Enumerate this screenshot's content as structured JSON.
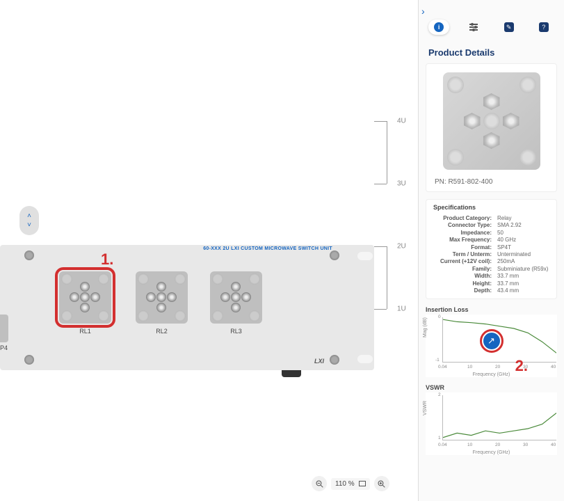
{
  "chassis_header": "60-XXX 2U LXI CUSTOM MICROWAVE SWITCH UNIT",
  "relays": [
    {
      "label": "RL1",
      "selected": true
    },
    {
      "label": "RL2",
      "selected": false
    },
    {
      "label": "RL3",
      "selected": false
    }
  ],
  "partial_label": "P4",
  "lxi_logo": "LXI",
  "rack_units": [
    "4U",
    "3U",
    "2U",
    "1U"
  ],
  "markers": {
    "one": "1.",
    "two": "2."
  },
  "zoom": {
    "out": "−",
    "in": "+",
    "label": "110 %"
  },
  "side_panel": {
    "chevron": "›",
    "section_title": "Product Details",
    "part_number": "PN: R591-802-400",
    "specs_title": "Specifications",
    "specs": [
      {
        "k": "Product Category:",
        "v": "Relay"
      },
      {
        "k": "Connector Type:",
        "v": "SMA 2.92"
      },
      {
        "k": "Impedance:",
        "v": "50"
      },
      {
        "k": "Max Frequency:",
        "v": "40 GHz"
      },
      {
        "k": "Format:",
        "v": "SP4T"
      },
      {
        "k": "Term / Unterm:",
        "v": "Unterminated"
      },
      {
        "k": "Current (+12V coil):",
        "v": "250mA"
      },
      {
        "k": "Family:",
        "v": "Subminiature (R59x)"
      },
      {
        "k": "Width:",
        "v": "33.7 mm"
      },
      {
        "k": "Height:",
        "v": "33.7 mm"
      },
      {
        "k": "Depth:",
        "v": "43.4 mm"
      }
    ],
    "chart1_title": "Insertion Loss",
    "chart2_title": "VSWR"
  },
  "chart_data": [
    {
      "type": "line",
      "title": "Insertion Loss",
      "xlabel": "Frequency (GHz)",
      "ylabel": "Mag (dB)",
      "xlim": [
        0.04,
        40
      ],
      "ylim": [
        -1,
        0
      ],
      "x_ticks": [
        0.04,
        10,
        20,
        30,
        40
      ],
      "y_ticks": [
        -1,
        0
      ],
      "x": [
        0.04,
        5,
        10,
        15,
        20,
        25,
        30,
        35,
        40
      ],
      "values": [
        -0.05,
        -0.1,
        -0.12,
        -0.15,
        -0.2,
        -0.25,
        -0.35,
        -0.55,
        -0.8
      ]
    },
    {
      "type": "line",
      "title": "VSWR",
      "xlabel": "Frequency (GHz)",
      "ylabel": "VSWR",
      "xlim": [
        0.04,
        40
      ],
      "ylim": [
        1,
        2
      ],
      "x_ticks": [
        0.04,
        10,
        20,
        30,
        40
      ],
      "y_ticks": [
        1,
        2
      ],
      "x": [
        0.04,
        5,
        10,
        15,
        20,
        25,
        30,
        35,
        40
      ],
      "values": [
        1.05,
        1.15,
        1.1,
        1.2,
        1.15,
        1.2,
        1.25,
        1.35,
        1.6
      ]
    }
  ]
}
